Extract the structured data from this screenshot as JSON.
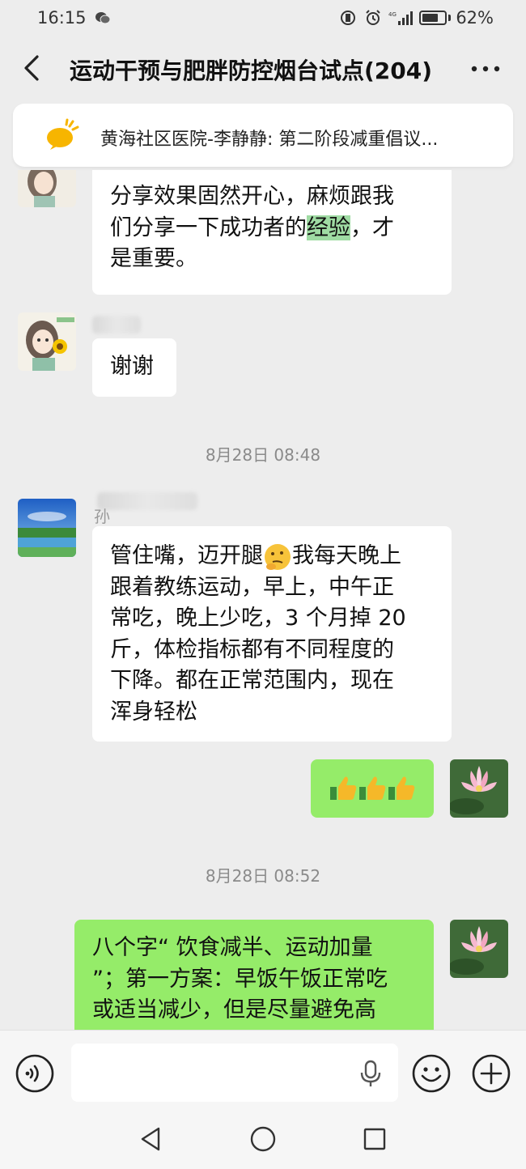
{
  "status_bar": {
    "time": "16:15",
    "battery": "62%",
    "network": "4G"
  },
  "header": {
    "title": "运动干预与肥胖防控烟台试点(204)"
  },
  "pinned_notice": {
    "text": "黄海社区医院-李静静: 第二阶段减重倡议..."
  },
  "messages": {
    "m1": {
      "lines": [
        "分享效果固然开心，麻烦跟我",
        "们分享一下成功者的",
        "经验",
        "，才",
        "是重要。"
      ]
    },
    "m2": {
      "text": "谢谢"
    },
    "ts1": "8月28日 08:48",
    "m3": {
      "sender_peek": "孙",
      "lines": [
        "管住嘴，迈开腿",
        "我每天晚上",
        "跟着教练运动，早上，中午正",
        "常吃，晚上少吃，3 个月掉 20",
        "斤，体检指标都有不同程度的",
        "下降。都在正常范围内，现在",
        "浑身轻松"
      ]
    },
    "m4": {
      "emoji": "thumbs-up x3"
    },
    "ts2": "8月28日 08:52",
    "m5": {
      "lines": [
        "八个字“ 饮食减半、运动加量",
        "”；第一方案：早饭午饭正常吃",
        "或适当减少，但是尽量避免高"
      ]
    }
  },
  "input_bar": {
    "placeholder": ""
  },
  "colors": {
    "background": "#ededed",
    "my_bubble": "#95ec69",
    "their_bubble": "#ffffff",
    "highlight": "#9fdba3"
  }
}
